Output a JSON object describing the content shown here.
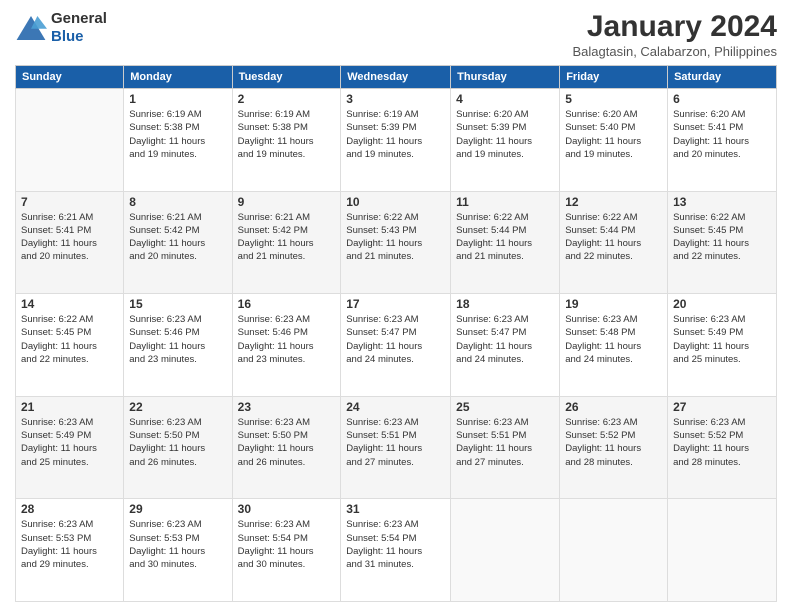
{
  "logo": {
    "line1": "General",
    "line2": "Blue"
  },
  "title": "January 2024",
  "subtitle": "Balagtasin, Calabarzon, Philippines",
  "days_of_week": [
    "Sunday",
    "Monday",
    "Tuesday",
    "Wednesday",
    "Thursday",
    "Friday",
    "Saturday"
  ],
  "weeks": [
    [
      {
        "day": "",
        "info": ""
      },
      {
        "day": "1",
        "info": "Sunrise: 6:19 AM\nSunset: 5:38 PM\nDaylight: 11 hours\nand 19 minutes."
      },
      {
        "day": "2",
        "info": "Sunrise: 6:19 AM\nSunset: 5:38 PM\nDaylight: 11 hours\nand 19 minutes."
      },
      {
        "day": "3",
        "info": "Sunrise: 6:19 AM\nSunset: 5:39 PM\nDaylight: 11 hours\nand 19 minutes."
      },
      {
        "day": "4",
        "info": "Sunrise: 6:20 AM\nSunset: 5:39 PM\nDaylight: 11 hours\nand 19 minutes."
      },
      {
        "day": "5",
        "info": "Sunrise: 6:20 AM\nSunset: 5:40 PM\nDaylight: 11 hours\nand 19 minutes."
      },
      {
        "day": "6",
        "info": "Sunrise: 6:20 AM\nSunset: 5:41 PM\nDaylight: 11 hours\nand 20 minutes."
      }
    ],
    [
      {
        "day": "7",
        "info": "Sunrise: 6:21 AM\nSunset: 5:41 PM\nDaylight: 11 hours\nand 20 minutes."
      },
      {
        "day": "8",
        "info": "Sunrise: 6:21 AM\nSunset: 5:42 PM\nDaylight: 11 hours\nand 20 minutes."
      },
      {
        "day": "9",
        "info": "Sunrise: 6:21 AM\nSunset: 5:42 PM\nDaylight: 11 hours\nand 21 minutes."
      },
      {
        "day": "10",
        "info": "Sunrise: 6:22 AM\nSunset: 5:43 PM\nDaylight: 11 hours\nand 21 minutes."
      },
      {
        "day": "11",
        "info": "Sunrise: 6:22 AM\nSunset: 5:44 PM\nDaylight: 11 hours\nand 21 minutes."
      },
      {
        "day": "12",
        "info": "Sunrise: 6:22 AM\nSunset: 5:44 PM\nDaylight: 11 hours\nand 22 minutes."
      },
      {
        "day": "13",
        "info": "Sunrise: 6:22 AM\nSunset: 5:45 PM\nDaylight: 11 hours\nand 22 minutes."
      }
    ],
    [
      {
        "day": "14",
        "info": "Sunrise: 6:22 AM\nSunset: 5:45 PM\nDaylight: 11 hours\nand 22 minutes."
      },
      {
        "day": "15",
        "info": "Sunrise: 6:23 AM\nSunset: 5:46 PM\nDaylight: 11 hours\nand 23 minutes."
      },
      {
        "day": "16",
        "info": "Sunrise: 6:23 AM\nSunset: 5:46 PM\nDaylight: 11 hours\nand 23 minutes."
      },
      {
        "day": "17",
        "info": "Sunrise: 6:23 AM\nSunset: 5:47 PM\nDaylight: 11 hours\nand 24 minutes."
      },
      {
        "day": "18",
        "info": "Sunrise: 6:23 AM\nSunset: 5:47 PM\nDaylight: 11 hours\nand 24 minutes."
      },
      {
        "day": "19",
        "info": "Sunrise: 6:23 AM\nSunset: 5:48 PM\nDaylight: 11 hours\nand 24 minutes."
      },
      {
        "day": "20",
        "info": "Sunrise: 6:23 AM\nSunset: 5:49 PM\nDaylight: 11 hours\nand 25 minutes."
      }
    ],
    [
      {
        "day": "21",
        "info": "Sunrise: 6:23 AM\nSunset: 5:49 PM\nDaylight: 11 hours\nand 25 minutes."
      },
      {
        "day": "22",
        "info": "Sunrise: 6:23 AM\nSunset: 5:50 PM\nDaylight: 11 hours\nand 26 minutes."
      },
      {
        "day": "23",
        "info": "Sunrise: 6:23 AM\nSunset: 5:50 PM\nDaylight: 11 hours\nand 26 minutes."
      },
      {
        "day": "24",
        "info": "Sunrise: 6:23 AM\nSunset: 5:51 PM\nDaylight: 11 hours\nand 27 minutes."
      },
      {
        "day": "25",
        "info": "Sunrise: 6:23 AM\nSunset: 5:51 PM\nDaylight: 11 hours\nand 27 minutes."
      },
      {
        "day": "26",
        "info": "Sunrise: 6:23 AM\nSunset: 5:52 PM\nDaylight: 11 hours\nand 28 minutes."
      },
      {
        "day": "27",
        "info": "Sunrise: 6:23 AM\nSunset: 5:52 PM\nDaylight: 11 hours\nand 28 minutes."
      }
    ],
    [
      {
        "day": "28",
        "info": "Sunrise: 6:23 AM\nSunset: 5:53 PM\nDaylight: 11 hours\nand 29 minutes."
      },
      {
        "day": "29",
        "info": "Sunrise: 6:23 AM\nSunset: 5:53 PM\nDaylight: 11 hours\nand 30 minutes."
      },
      {
        "day": "30",
        "info": "Sunrise: 6:23 AM\nSunset: 5:54 PM\nDaylight: 11 hours\nand 30 minutes."
      },
      {
        "day": "31",
        "info": "Sunrise: 6:23 AM\nSunset: 5:54 PM\nDaylight: 11 hours\nand 31 minutes."
      },
      {
        "day": "",
        "info": ""
      },
      {
        "day": "",
        "info": ""
      },
      {
        "day": "",
        "info": ""
      }
    ]
  ]
}
